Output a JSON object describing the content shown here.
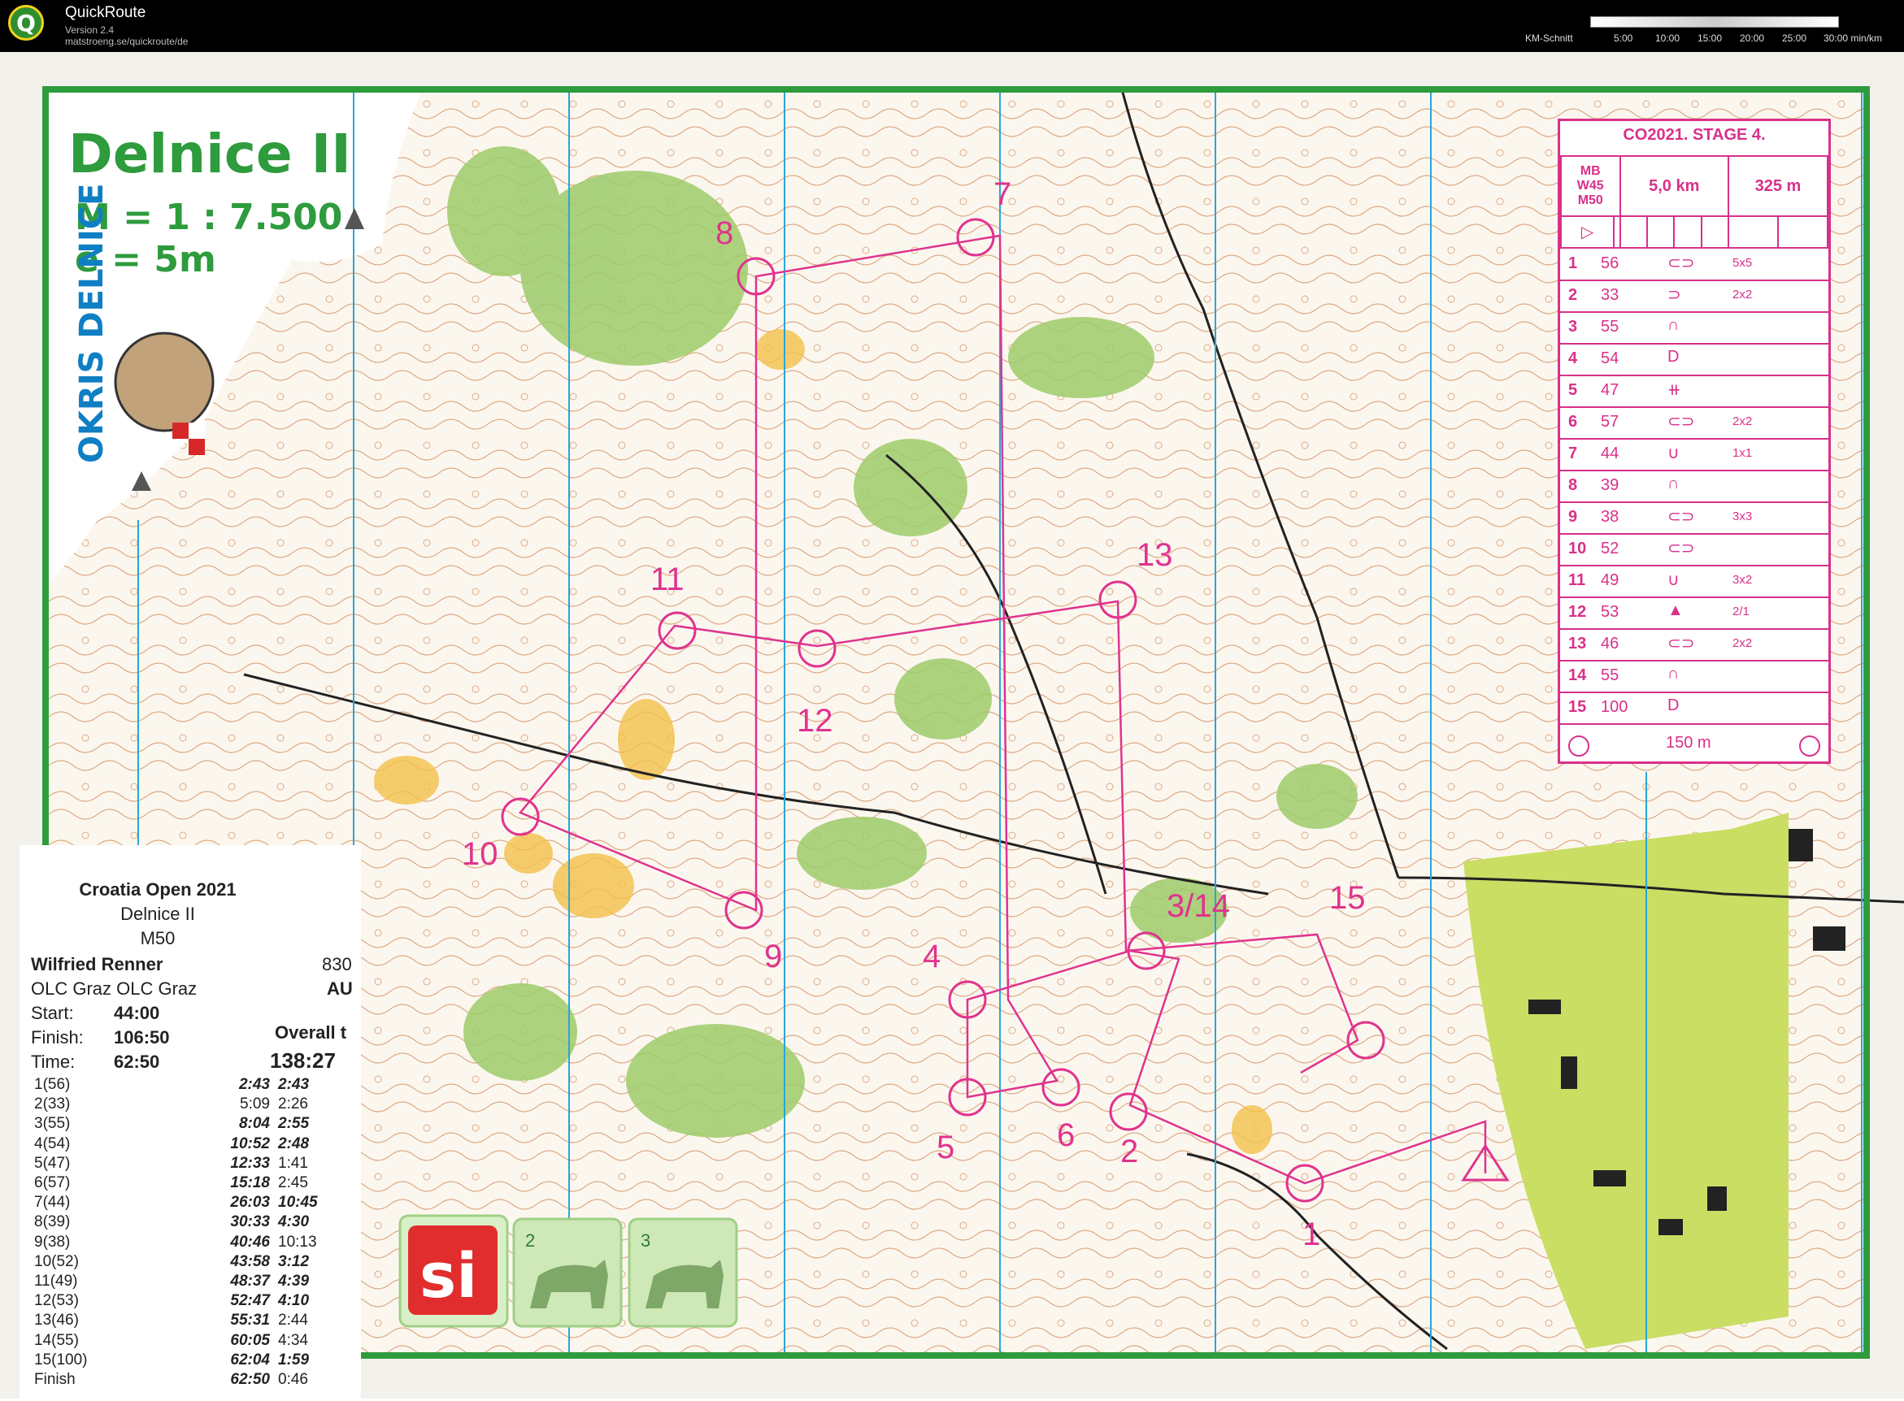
{
  "app": {
    "title": "QuickRoute",
    "version": "Version 2.4",
    "url": "matstroeng.se/quickroute/de",
    "km_label": "KM-Schnitt",
    "legend_ticks": [
      "5:00",
      "10:00",
      "15:00",
      "20:00",
      "25:00",
      "30:00 min/km"
    ]
  },
  "map": {
    "name": "Delnice II",
    "scale": "M = 1 : 7.500",
    "contour": "e = 5m",
    "club_logo": "OKRIS DELNICE",
    "control_numbers": [
      "1",
      "2",
      "3/14",
      "4",
      "5",
      "6",
      "7",
      "8",
      "9",
      "10",
      "11",
      "12",
      "13",
      "15"
    ],
    "colors": {
      "course": "#e0338e",
      "frame": "#2e9b3d",
      "contours": "#b5652f"
    }
  },
  "description": {
    "title": "CO2021. STAGE 4.",
    "classes": [
      "MB",
      "W45",
      "M50"
    ],
    "length": "5,0 km",
    "climb": "325 m",
    "rows": [
      {
        "n": "1",
        "code": "56",
        "dim": "5x5"
      },
      {
        "n": "2",
        "code": "33",
        "dim": "2x2"
      },
      {
        "n": "3",
        "code": "55",
        "dim": ""
      },
      {
        "n": "4",
        "code": "54",
        "dim": ""
      },
      {
        "n": "5",
        "code": "47",
        "dim": ""
      },
      {
        "n": "6",
        "code": "57",
        "dim": "2x2"
      },
      {
        "n": "7",
        "code": "44",
        "dim": "1x1"
      },
      {
        "n": "8",
        "code": "39",
        "dim": ""
      },
      {
        "n": "9",
        "code": "38",
        "dim": "3x3"
      },
      {
        "n": "10",
        "code": "52",
        "dim": ""
      },
      {
        "n": "11",
        "code": "49",
        "dim": "3x2"
      },
      {
        "n": "12",
        "code": "53",
        "dim": "2/1"
      },
      {
        "n": "13",
        "code": "46",
        "dim": "2x2"
      },
      {
        "n": "14",
        "code": "55",
        "dim": ""
      },
      {
        "n": "15",
        "code": "100",
        "dim": ""
      }
    ],
    "finish_distance": "150 m"
  },
  "splits": {
    "event": "Croatia Open 2021",
    "map": "Delnice II",
    "class": "M50",
    "runner": "Wilfried Renner",
    "bib": "830",
    "club": "OLC Graz OLC Graz",
    "country": "AU",
    "start_label": "Start:",
    "start": "44:00",
    "finish_label": "Finish:",
    "finish": "106:50",
    "time_label": "Time:",
    "time": "62:50",
    "overall_label": "Overall t",
    "overall": "138:27",
    "rows": [
      {
        "label": "1(56)",
        "cum": "2:43",
        "leg": "2:43",
        "cb": true,
        "lb": true
      },
      {
        "label": "2(33)",
        "cum": "5:09",
        "leg": "2:26",
        "cb": false,
        "lb": false
      },
      {
        "label": "3(55)",
        "cum": "8:04",
        "leg": "2:55",
        "cb": true,
        "lb": true
      },
      {
        "label": "4(54)",
        "cum": "10:52",
        "leg": "2:48",
        "cb": true,
        "lb": true
      },
      {
        "label": "5(47)",
        "cum": "12:33",
        "leg": "1:41",
        "cb": true,
        "lb": false
      },
      {
        "label": "6(57)",
        "cum": "15:18",
        "leg": "2:45",
        "cb": true,
        "lb": false
      },
      {
        "label": "7(44)",
        "cum": "26:03",
        "leg": "10:45",
        "cb": true,
        "lb": true
      },
      {
        "label": "8(39)",
        "cum": "30:33",
        "leg": "4:30",
        "cb": true,
        "lb": true
      },
      {
        "label": "9(38)",
        "cum": "40:46",
        "leg": "10:13",
        "cb": true,
        "lb": false
      },
      {
        "label": "10(52)",
        "cum": "43:58",
        "leg": "3:12",
        "cb": true,
        "lb": true
      },
      {
        "label": "11(49)",
        "cum": "48:37",
        "leg": "4:39",
        "cb": true,
        "lb": true
      },
      {
        "label": "12(53)",
        "cum": "52:47",
        "leg": "4:10",
        "cb": true,
        "lb": true
      },
      {
        "label": "13(46)",
        "cum": "55:31",
        "leg": "2:44",
        "cb": true,
        "lb": false
      },
      {
        "label": "14(55)",
        "cum": "60:05",
        "leg": "4:34",
        "cb": true,
        "lb": false
      },
      {
        "label": "15(100)",
        "cum": "62:04",
        "leg": "1:59",
        "cb": true,
        "lb": true
      },
      {
        "label": "Finish",
        "cum": "62:50",
        "leg": "0:46",
        "cb": true,
        "lb": false
      }
    ]
  },
  "sponsor_logos": {
    "si": "si",
    "badge2": "2",
    "badge3": "3"
  }
}
